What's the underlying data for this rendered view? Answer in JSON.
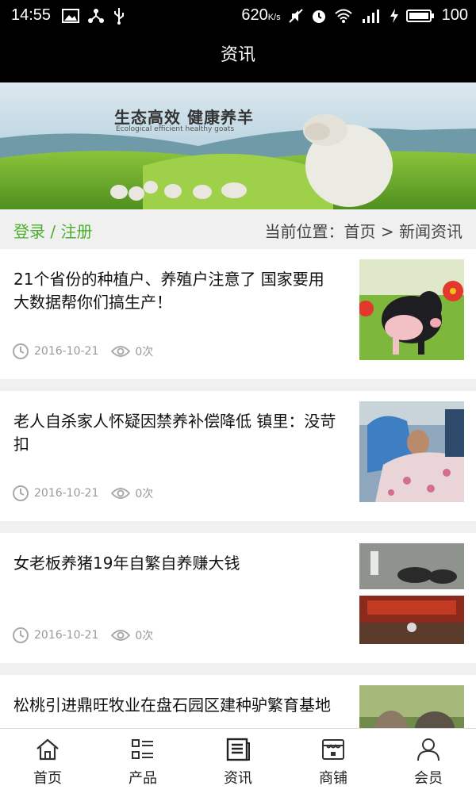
{
  "status": {
    "time": "14:55",
    "speed": "620",
    "speed_unit": "K/s",
    "battery": "100"
  },
  "header": {
    "title": "资讯"
  },
  "banner": {
    "slogan": "生态高效  健康养羊",
    "slogan_en": "Ecological efficient healthy goats"
  },
  "breadcrumb": {
    "login": "登录 / 注册",
    "location": "当前位置：首页 > 新闻资讯"
  },
  "news": [
    {
      "title": "21个省份的种植户、养殖户注意了 国家要用大数据帮你们搞生产！",
      "date": "2016-10-21",
      "views": "0次",
      "thumb": "pig-photo"
    },
    {
      "title": "老人自杀家人怀疑因禁养补偿降低 镇里：没苛扣",
      "date": "2016-10-21",
      "views": "0次",
      "thumb": "elder-in-bed-photo"
    },
    {
      "title": "女老板养猪19年自繁自养赚大钱",
      "date": "2016-10-21",
      "views": "0次",
      "thumb": "pig-farm-and-meeting-photo"
    },
    {
      "title": "松桃引进鼎旺牧业在盘石园区建种驴繁育基地",
      "date": "",
      "views": "",
      "thumb": "donkey-photo"
    }
  ],
  "tabs": [
    {
      "label": "首页",
      "icon": "home-icon"
    },
    {
      "label": "产品",
      "icon": "product-list-icon"
    },
    {
      "label": "资讯",
      "icon": "news-icon"
    },
    {
      "label": "商铺",
      "icon": "store-icon"
    },
    {
      "label": "会员",
      "icon": "member-icon"
    }
  ],
  "colors": {
    "accent_green": "#4cae2c",
    "topbar": "#000000"
  }
}
